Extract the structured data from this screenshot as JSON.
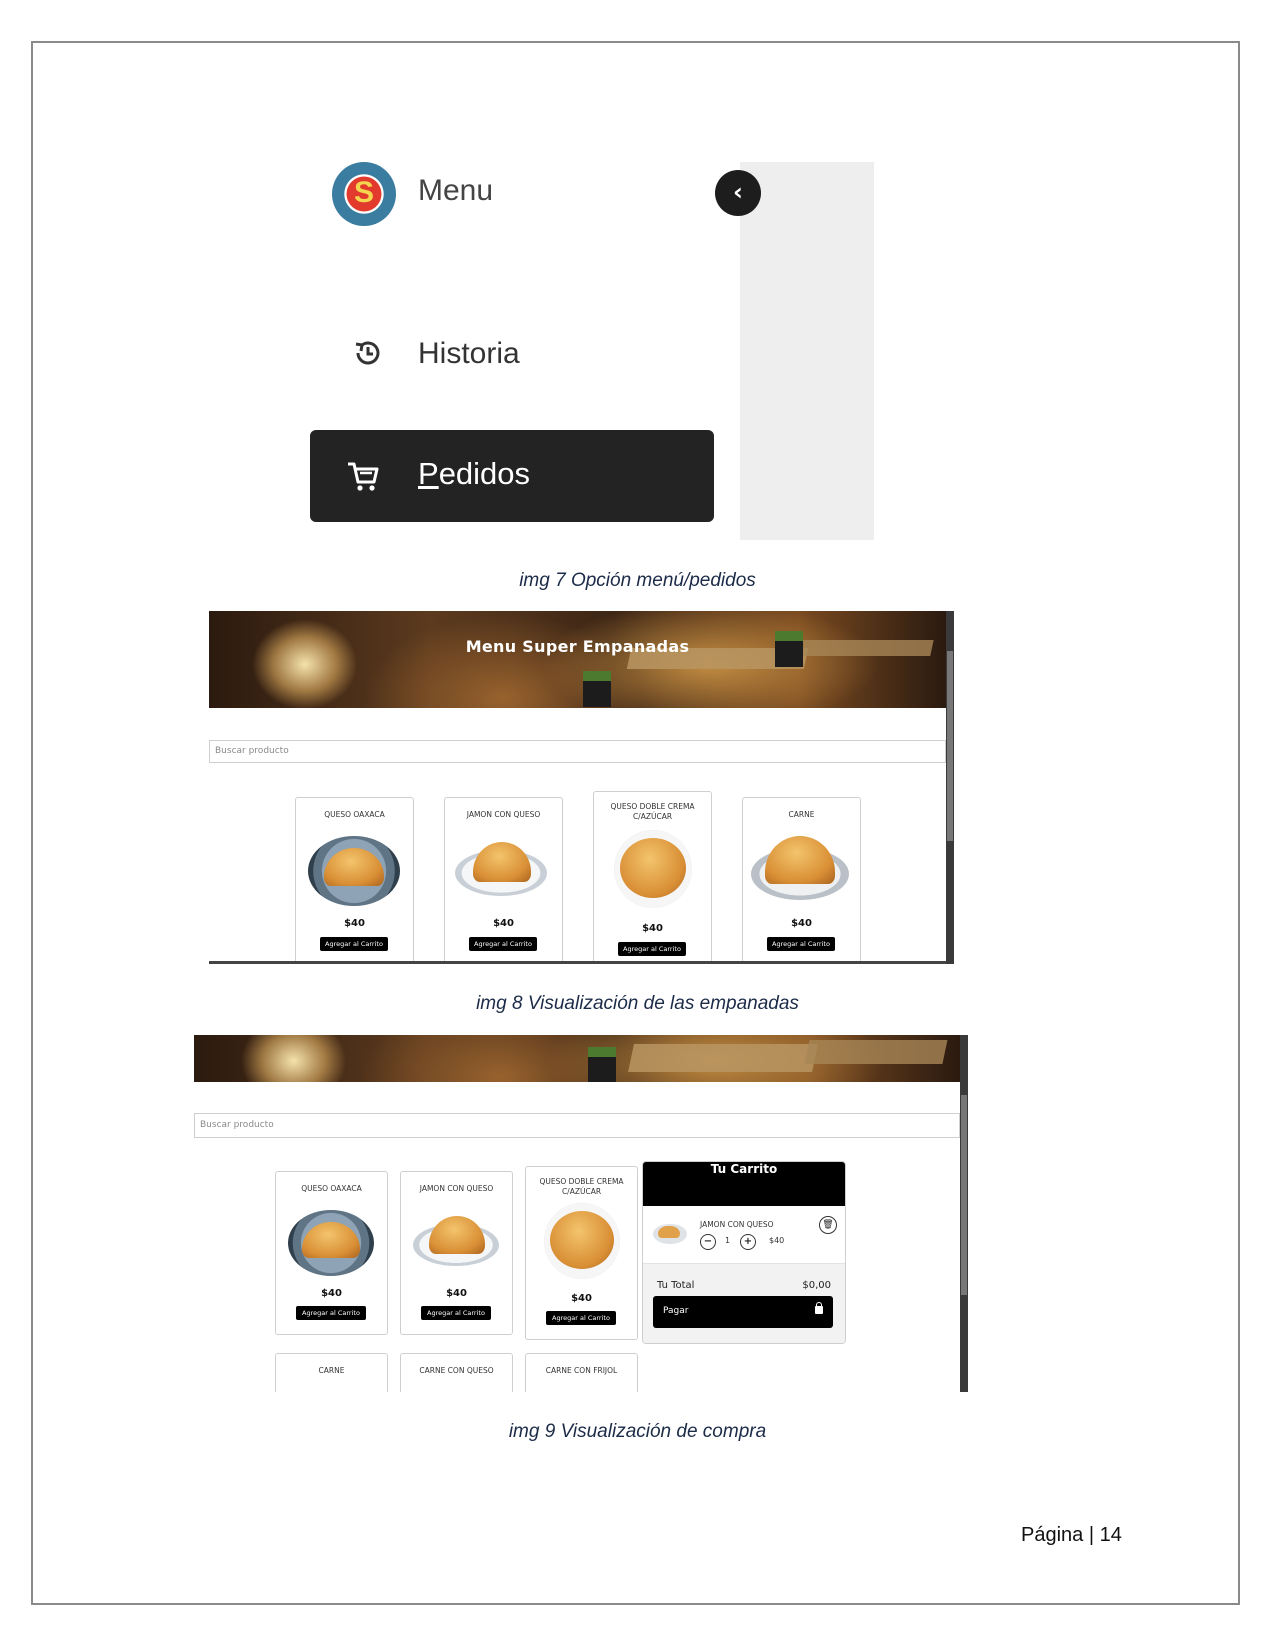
{
  "fig7": {
    "menu_title": "Menu",
    "collapse_glyph": "‹",
    "logo_letter": "S",
    "historia_label": "Historia",
    "pedidos_label": "Pedidos"
  },
  "captions": {
    "img7": "img 7 Opción menú/pedidos",
    "img8": "img 8 Visualización de las empanadas",
    "img9": "img 9 Visualización de compra"
  },
  "fig8": {
    "banner_title": "Menu Super Empanadas",
    "search_placeholder": "Buscar producto",
    "products": [
      {
        "name": "QUESO OAXACA",
        "price": "$40",
        "button": "Agregar al Carrito"
      },
      {
        "name": "JAMON CON QUESO",
        "price": "$40",
        "button": "Agregar al Carrito"
      },
      {
        "name": "QUESO DOBLE CREMA C/AZÚCAR",
        "price": "$40",
        "button": "Agregar al Carrito"
      },
      {
        "name": "CARNE",
        "price": "$40",
        "button": "Agregar al Carrito"
      }
    ]
  },
  "fig9": {
    "search_placeholder": "Buscar producto",
    "products": [
      {
        "name": "QUESO OAXACA",
        "price": "$40",
        "button": "Agregar al Carrito"
      },
      {
        "name": "JAMON CON QUESO",
        "price": "$40",
        "button": "Agregar al Carrito"
      },
      {
        "name": "QUESO DOBLE CREMA C/AZÚCAR",
        "price": "$40",
        "button": "Agregar al Carrito"
      },
      {
        "name": "CARNE"
      },
      {
        "name": "CARNE CON QUESO"
      },
      {
        "name": "CARNE CON FRIJOL"
      }
    ],
    "cart": {
      "title": "Tu Carrito",
      "item_name": "JAMON CON QUESO",
      "minus": "−",
      "quantity": "1",
      "plus": "+",
      "item_price": "$40",
      "total_label": "Tu Total",
      "total_value": "$0,00",
      "pay_label": "Pagar"
    }
  },
  "footer": {
    "page_number": "Página | 14"
  },
  "colors": {
    "sidebar_active": "#232323",
    "button_black": "#000000",
    "caption": "#1c2b48"
  }
}
